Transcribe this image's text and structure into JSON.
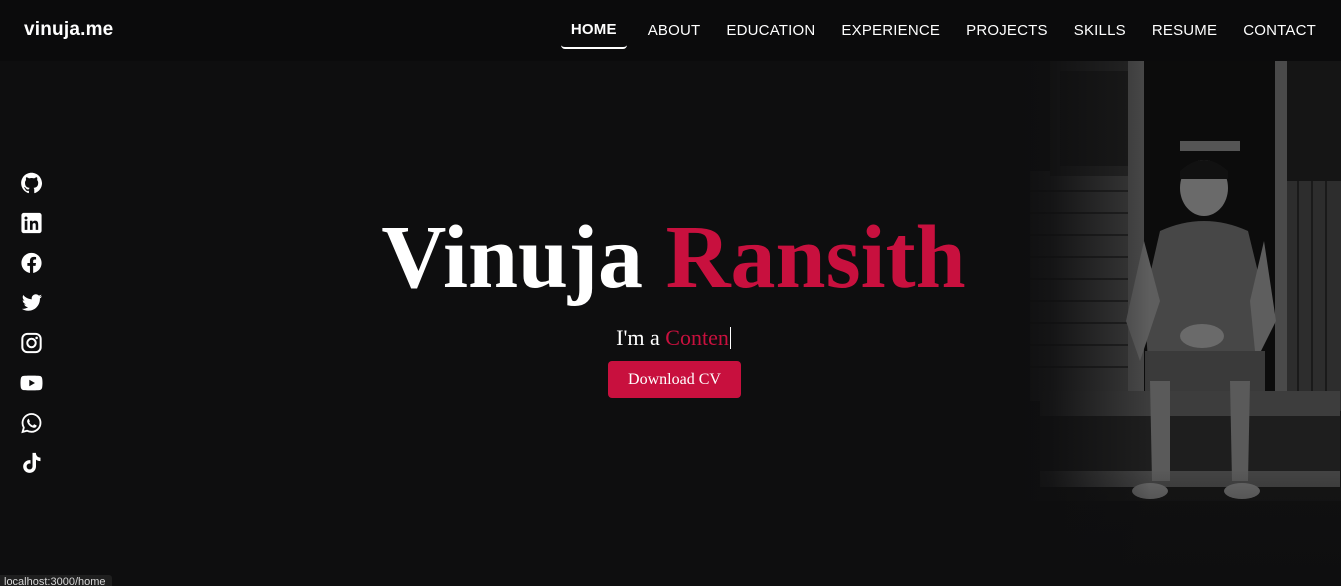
{
  "brand": {
    "logo": "vinuja.me"
  },
  "nav": {
    "items": [
      {
        "label": "HOME",
        "active": true
      },
      {
        "label": "ABOUT",
        "active": false
      },
      {
        "label": "EDUCATION",
        "active": false
      },
      {
        "label": "EXPERIENCE",
        "active": false
      },
      {
        "label": "PROJECTS",
        "active": false
      },
      {
        "label": "SKILLS",
        "active": false
      },
      {
        "label": "RESUME",
        "active": false
      },
      {
        "label": "CONTACT",
        "active": false
      }
    ]
  },
  "social": {
    "icons": [
      "github-icon",
      "linkedin-icon",
      "facebook-icon",
      "twitter-icon",
      "instagram-icon",
      "youtube-icon",
      "whatsapp-icon",
      "tiktok-icon"
    ]
  },
  "hero": {
    "first_name": "Vinuja",
    "last_name": "Ransith",
    "role_prefix": "I'm a",
    "role_typed": "Conten",
    "cv_button": "Download CV"
  },
  "status_bar": {
    "url": "localhost:3000/home"
  },
  "colors": {
    "background": "#0e0e0f",
    "navbar": "#0b0b0c",
    "accent": "#c8103e",
    "text": "#ffffff"
  }
}
